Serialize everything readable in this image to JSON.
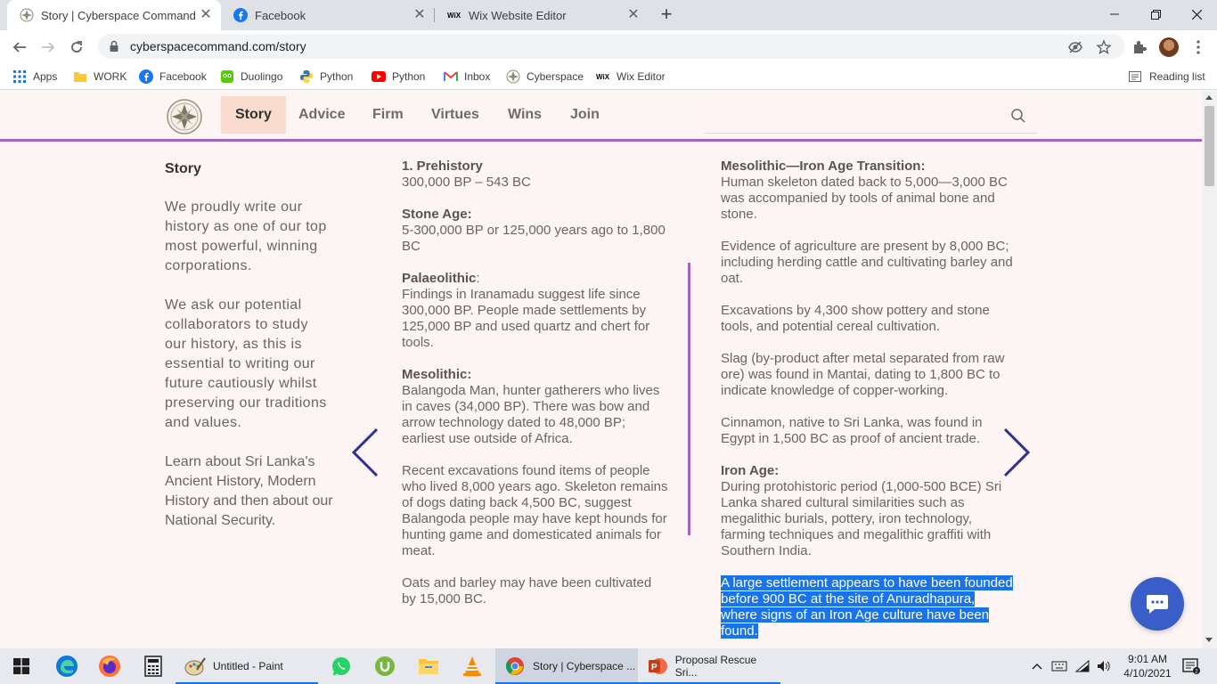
{
  "browser": {
    "tabs": [
      {
        "title": "Story | Cyberspace Command",
        "active": true,
        "icon": "cyberspace-star-icon"
      },
      {
        "title": "Facebook",
        "active": false,
        "icon": "facebook-icon"
      },
      {
        "title": "Wix Website Editor",
        "active": false,
        "icon": "wix-icon"
      }
    ],
    "url": "cyberspacecommand.com/story",
    "bookmarks": [
      {
        "label": "Apps",
        "icon": "apps-grid-icon"
      },
      {
        "label": "WORK",
        "icon": "folder-icon"
      },
      {
        "label": "Facebook",
        "icon": "facebook-icon"
      },
      {
        "label": "Duolingo",
        "icon": "duolingo-icon"
      },
      {
        "label": "Python",
        "icon": "python-icon"
      },
      {
        "label": "Python",
        "icon": "youtube-icon"
      },
      {
        "label": "Inbox",
        "icon": "gmail-icon"
      },
      {
        "label": "Cyberspace",
        "icon": "cyberspace-star-icon"
      },
      {
        "label": "Wix Editor",
        "icon": "wix-icon"
      }
    ],
    "reading_list": "Reading list"
  },
  "site": {
    "nav": [
      {
        "label": "Story",
        "active": true
      },
      {
        "label": "Advice",
        "active": false
      },
      {
        "label": "Firm",
        "active": false
      },
      {
        "label": "Virtues",
        "active": false
      },
      {
        "label": "Wins",
        "active": false
      },
      {
        "label": "Join",
        "active": false
      }
    ],
    "accent_color": "#a266c8",
    "left": {
      "title": "Story",
      "p1": "We proudly write our history as one of our top most powerful, winning corporations.",
      "p2": "We ask our potential collaborators to study our history, as this is essential to writing our future cautiously whilst preserving our traditions and values.",
      "p3": "Learn about Sri Lanka's Ancient History, Modern History and then about our National Security."
    },
    "middle": {
      "prehistory_heading": "1. Prehistory",
      "prehistory_text": "300,000 BP – 543 BC",
      "stone_heading": "Stone Age:",
      "stone_text": "5-300,000 BP or 125,000 years ago to 1,800 BC",
      "palaeo_heading": "Palaeolithic",
      "palaeo_colon": ":",
      "palaeo_text": "Findings in Iranamadu suggest life since 300,000 BP. People made settlements by 125,000 BP and used quartz and chert for tools.",
      "meso_heading": "Mesolithic:",
      "meso_text": "Balangoda Man, hunter gatherers who lives in caves (34,000 BP). There was bow and arrow technology dated to 48,000 BP; earliest use outside of Africa.",
      "recent_text": "Recent excavations found items of people who lived 8,000 years ago. Skeleton remains of dogs dating back 4,500 BC, suggest Balangoda people may have kept hounds for hunting game and domesticated animals for meat.",
      "oats_text": "Oats and barley may have been cultivated by 15,000 BC."
    },
    "right": {
      "transition_heading": "Mesolithic—Iron Age Transition:",
      "transition_text": "Human skeleton dated back to 5,000—3,000 BC was accompanied by tools of animal bone and stone.",
      "agri_text": "Evidence of agriculture are present by 8,000 BC; including herding cattle and cultivating barley and oat.",
      "excav_text": "Excavations by 4,300 show pottery and stone tools, and potential cereal cultivation.",
      "slag_text": "Slag (by-product after metal separated from raw ore) was found in Mantai, dating to 1,800 BC to indicate knowledge of copper-working.",
      "cinnamon_text": "Cinnamon, native to Sri Lanka, was found in Egypt in 1,500 BC as proof of ancient trade.",
      "iron_heading": "Iron Age:",
      "iron_text": "During protohistoric period (1,000-500 BCE) Sri Lanka shared cultural similarities such as megalithic burials, pottery, iron technology, farming techniques and megalithic graffiti with Southern India.",
      "highlight_text": "A large settlement appears to have been founded before 900 BC at the site of Anuradhapura, where signs of an Iron Age culture have been found."
    }
  },
  "taskbar": {
    "apps": [
      {
        "label": "Untitled - Paint",
        "icon": "paint-icon"
      },
      {
        "label": "Story | Cyberspace ...",
        "icon": "chrome-icon"
      },
      {
        "label": "Proposal Rescue Sri...",
        "icon": "powerpoint-icon"
      }
    ],
    "time": "9:01 AM",
    "date": "4/10/2021"
  }
}
